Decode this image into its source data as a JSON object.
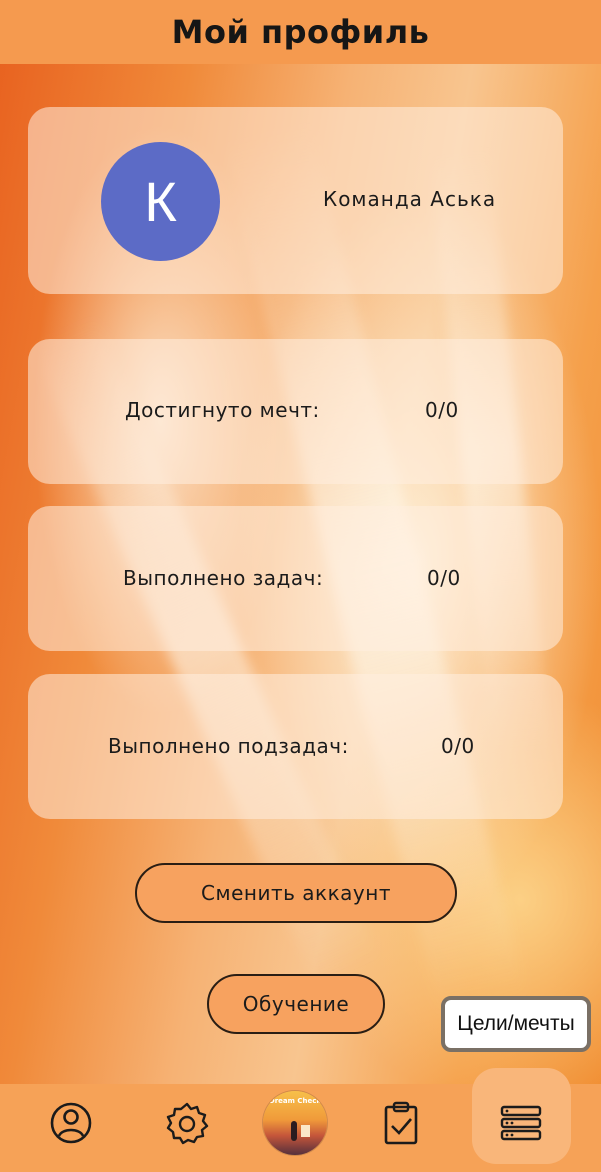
{
  "header": {
    "title": "Мой профиль"
  },
  "profile": {
    "avatar_letter": "К",
    "name": "Команда Аська",
    "avatar_color": "#5c6bc6"
  },
  "stats": [
    {
      "label": "Достигнуто мечт:",
      "value": "0/0"
    },
    {
      "label": "Выполнено задач:",
      "value": "0/0"
    },
    {
      "label": "Выполнено подзадач:",
      "value": "0/0"
    }
  ],
  "buttons": {
    "switch_account": "Сменить аккаунт",
    "tutorial": "Обучение"
  },
  "tooltip": {
    "text": "Цели/мечты"
  },
  "navbar": {
    "items": [
      {
        "icon": "profile-icon"
      },
      {
        "icon": "settings-gear-icon"
      },
      {
        "icon": "app-logo-icon",
        "text": "Dream Check"
      },
      {
        "icon": "tasks-clipboard-icon"
      },
      {
        "icon": "goals-list-icon",
        "active": true
      }
    ]
  },
  "colors": {
    "header_bg": "#f59a4f",
    "navbar_bg": "#f6a257",
    "button_bg": "#f7a25f",
    "nav_active_bg": "#f9b67a"
  }
}
